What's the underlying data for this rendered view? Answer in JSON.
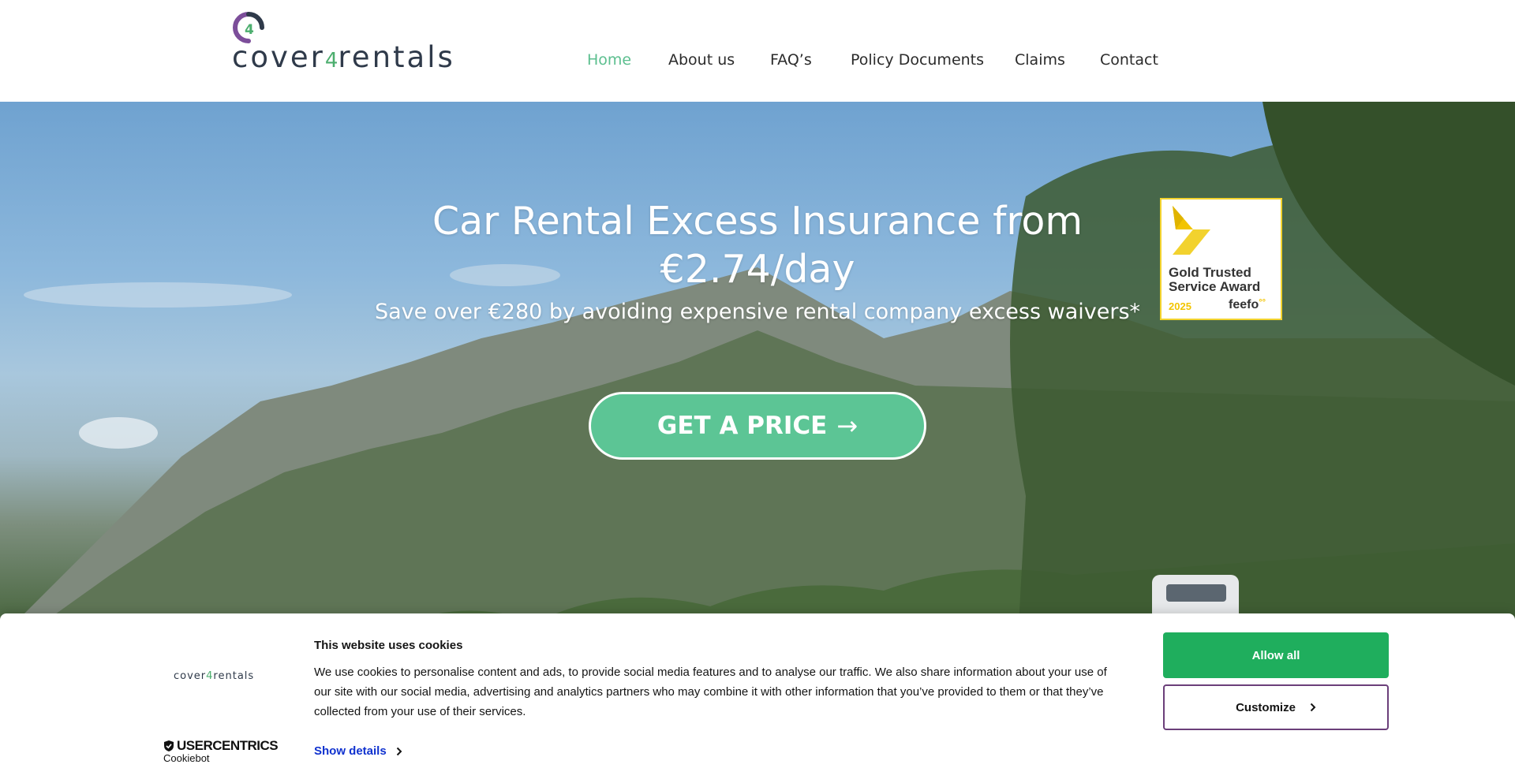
{
  "logo": {
    "text_before": "cover",
    "text_four": "4",
    "text_after": "rentals",
    "mark_digit": "4"
  },
  "nav": {
    "items": [
      {
        "label": "Home"
      },
      {
        "label": "About us"
      },
      {
        "label": "FAQ’s"
      },
      {
        "label": "Policy Documents"
      },
      {
        "label": "Claims"
      },
      {
        "label": "Contact"
      }
    ]
  },
  "hero": {
    "title_line1": "Car Rental Excess Insurance from",
    "title_line2": "€2.74/day",
    "subtitle": "Save over €280 by avoiding expensive rental company excess waivers*",
    "cta_label": "GET A PRICE",
    "cta_arrow": "→"
  },
  "award": {
    "title": "Gold Trusted Service Award",
    "year": "2025",
    "brand": "feefo",
    "brand_dots": "°°"
  },
  "cookie": {
    "logo_text_before": "cover",
    "logo_text_four": "4",
    "logo_text_after": "rentals",
    "title": "This website uses cookies",
    "body": "We use cookies to personalise content and ads, to provide social media features and to analyse our traffic. We also share information about your use of our site with our social media, advertising and analytics partners who may combine it with other information that you’ve provided to them or that they’ve collected from your use of their services.",
    "details_label": "Show details",
    "allow_label": "Allow all",
    "customize_label": "Customize",
    "provider_name": "USERCENTRICS",
    "provider_sub": "Cookiebot"
  },
  "colors": {
    "accent_green": "#5cc595",
    "nav_active": "#5cbf8f",
    "allow_button": "#1fae5d",
    "customize_border": "#6b3f7a",
    "link_blue": "#1032cf"
  },
  "icons": [
    "logo-mark-icon",
    "arrow-right-icon",
    "trophy-icon",
    "chevron-right-icon",
    "shield-icon"
  ]
}
